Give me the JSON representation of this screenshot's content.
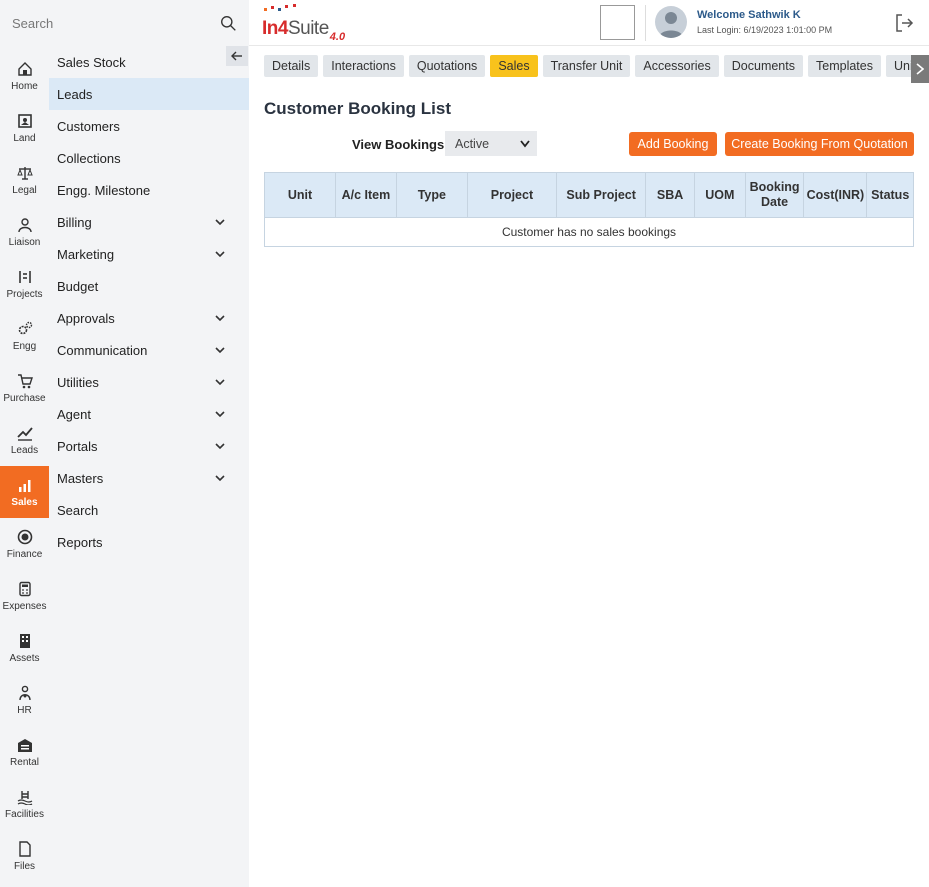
{
  "search": {
    "placeholder": "Search"
  },
  "logo": {
    "part1": "In4",
    "part2": "Suite",
    "version": "4.0"
  },
  "user": {
    "welcome": "Welcome Sathwik K",
    "last_login": "Last Login: 6/19/2023 1:01:00 PM"
  },
  "rail": [
    {
      "label": "Home",
      "icon": "home-icon"
    },
    {
      "label": "Land",
      "icon": "land-icon"
    },
    {
      "label": "Legal",
      "icon": "scales-icon"
    },
    {
      "label": "Liaison",
      "icon": "person-icon"
    },
    {
      "label": "Projects",
      "icon": "projects-icon"
    },
    {
      "label": "Engg",
      "icon": "gears-icon"
    },
    {
      "label": "Purchase",
      "icon": "cart-icon"
    },
    {
      "label": "Leads",
      "icon": "trend-icon"
    },
    {
      "label": "Sales",
      "icon": "bar-chart-icon",
      "active": true
    },
    {
      "label": "Finance",
      "icon": "coin-icon"
    },
    {
      "label": "Expenses",
      "icon": "calculator-icon"
    },
    {
      "label": "Assets",
      "icon": "building-icon"
    },
    {
      "label": "HR",
      "icon": "people-icon"
    },
    {
      "label": "Rental",
      "icon": "warehouse-icon"
    },
    {
      "label": "Facilities",
      "icon": "pool-icon"
    },
    {
      "label": "Files",
      "icon": "file-icon"
    }
  ],
  "submenu": [
    {
      "label": "Sales Stock"
    },
    {
      "label": "Leads",
      "active": true
    },
    {
      "label": "Customers"
    },
    {
      "label": "Collections"
    },
    {
      "label": "Engg. Milestone"
    },
    {
      "label": "Billing",
      "expandable": true
    },
    {
      "label": "Marketing",
      "expandable": true
    },
    {
      "label": "Budget"
    },
    {
      "label": "Approvals",
      "expandable": true
    },
    {
      "label": "Communication",
      "expandable": true
    },
    {
      "label": "Utilities",
      "expandable": true
    },
    {
      "label": "Agent",
      "expandable": true
    },
    {
      "label": "Portals",
      "expandable": true
    },
    {
      "label": "Masters",
      "expandable": true
    },
    {
      "label": "Search"
    },
    {
      "label": "Reports"
    }
  ],
  "tabs": [
    {
      "label": "Details"
    },
    {
      "label": "Interactions"
    },
    {
      "label": "Quotations"
    },
    {
      "label": "Sales",
      "active": true
    },
    {
      "label": "Transfer Unit"
    },
    {
      "label": "Accessories"
    },
    {
      "label": "Documents"
    },
    {
      "label": "Templates"
    },
    {
      "label": "Unit R"
    }
  ],
  "page": {
    "title": "Customer Booking List",
    "view_bookings_label": "View Bookings",
    "view_bookings_value": "Active",
    "add_booking": "Add Booking",
    "create_from_quotation": "Create Booking From Quotation"
  },
  "table": {
    "headers": [
      "Unit",
      "A/c Item",
      "Type",
      "Project",
      "Sub Project",
      "SBA",
      "UOM",
      "Booking Date",
      "Cost(INR)",
      "Status"
    ],
    "empty_message": "Customer has no sales bookings"
  },
  "colors": {
    "accent": "#f26c22",
    "active_tab": "#f8c21c",
    "highlight": "#dbe9f6"
  }
}
